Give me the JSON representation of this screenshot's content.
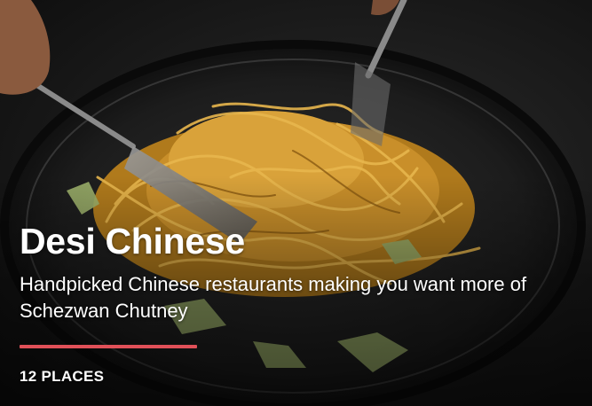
{
  "collection": {
    "title": "Desi Chinese",
    "subtitle": "Handpicked Chinese restaurants making you want more of Schezwan Chutney",
    "places_count": "12 PLACES"
  },
  "colors": {
    "accent_divider": "#e05058",
    "text": "#ffffff"
  }
}
